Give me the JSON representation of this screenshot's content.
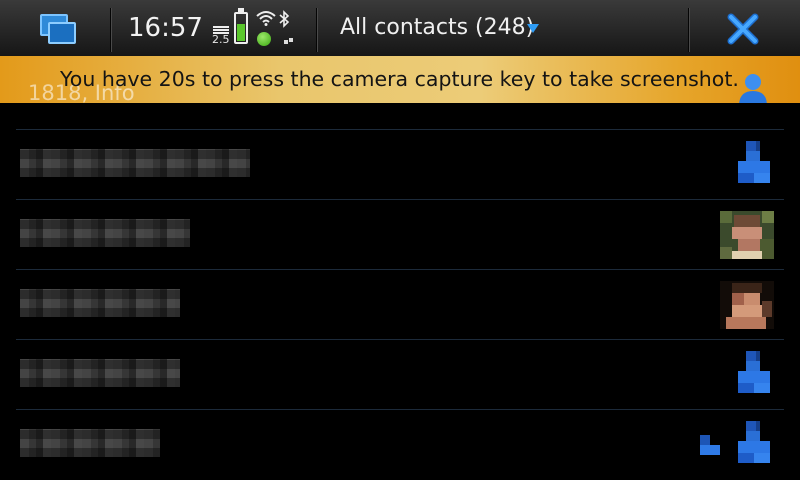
{
  "status_bar": {
    "clock": "16:57",
    "network_label": "2.5",
    "battery_level": 0.65,
    "view_title": "All contacts (248)",
    "icons": {
      "task_switcher": "task-switcher-icon",
      "battery": "battery-icon",
      "wifi": "wifi-icon",
      "presence": "presence-online-icon",
      "bluetooth": "bluetooth-icon",
      "dropdown": "dropdown-arrow-icon",
      "close": "close-icon"
    }
  },
  "banner": {
    "message": "You have 20s to press the camera capture key to take screenshot.",
    "underlying_text": "1818, Info",
    "icon": "person-avatar-icon"
  },
  "contacts": [
    {
      "name": "",
      "avatar": "person-placeholder-icon"
    },
    {
      "name": "",
      "avatar": "contact-photo"
    },
    {
      "name": "",
      "avatar": "contact-photo"
    },
    {
      "name": "",
      "avatar": "person-placeholder-icon"
    },
    {
      "name": "",
      "avatar": "person-placeholder-icon",
      "presence": "presence-tag-icon"
    }
  ],
  "colors": {
    "accent_blue": "#2e9cf5",
    "banner_orange": "#e39a1a",
    "banner_yellow": "#eccc78",
    "presence_green": "#3aa80f"
  }
}
